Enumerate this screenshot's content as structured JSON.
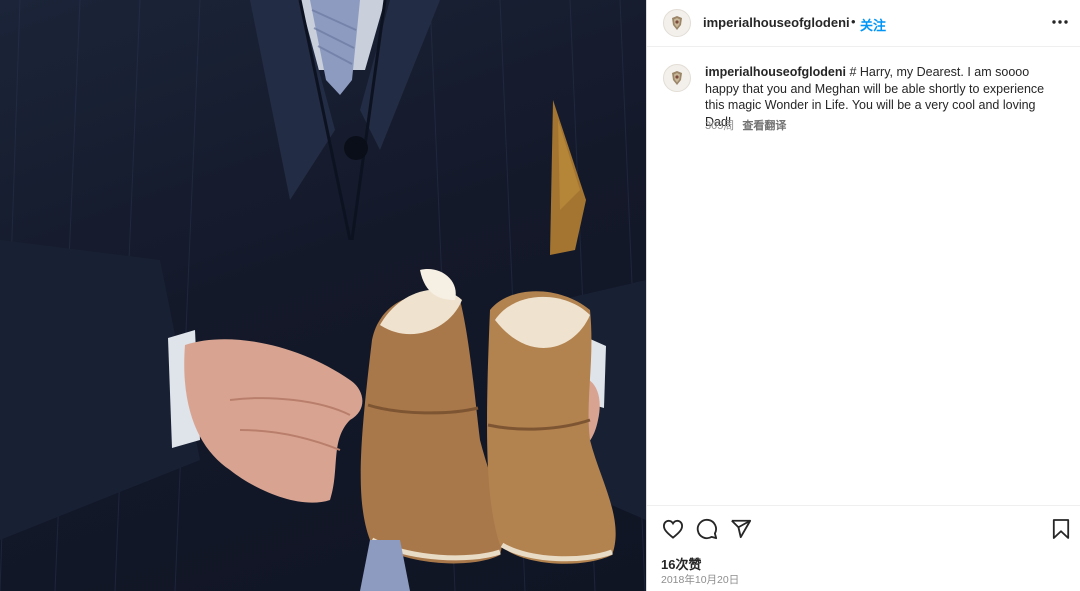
{
  "post": {
    "username": "imperialhouseofglodeni",
    "separator": "•",
    "follow_label": "关注",
    "more_icon": "more-horizontal-icon",
    "photo_alt": "hands holding a pair of tan sheepskin baby boots"
  },
  "caption": {
    "username": "imperialhouseofglodeni",
    "text": "# Harry, my Dearest. I am soooo happy that you and Meghan will be able shortly to experience this magic Wonder in Life. You will be a very cool and loving Dad!",
    "age": "305周",
    "translate_label": "查看翻译"
  },
  "actions": {
    "like_icon": "heart-icon",
    "comment_icon": "comment-icon",
    "share_icon": "send-icon",
    "save_icon": "bookmark-icon"
  },
  "stats": {
    "likes": "16次赞",
    "date": "2018年10月20日"
  },
  "colors": {
    "link_blue": "#0095f6",
    "text": "#262626",
    "muted": "#8e8e8e",
    "suit_navy": "#1b2438",
    "boot_tan": "#a9784a"
  }
}
